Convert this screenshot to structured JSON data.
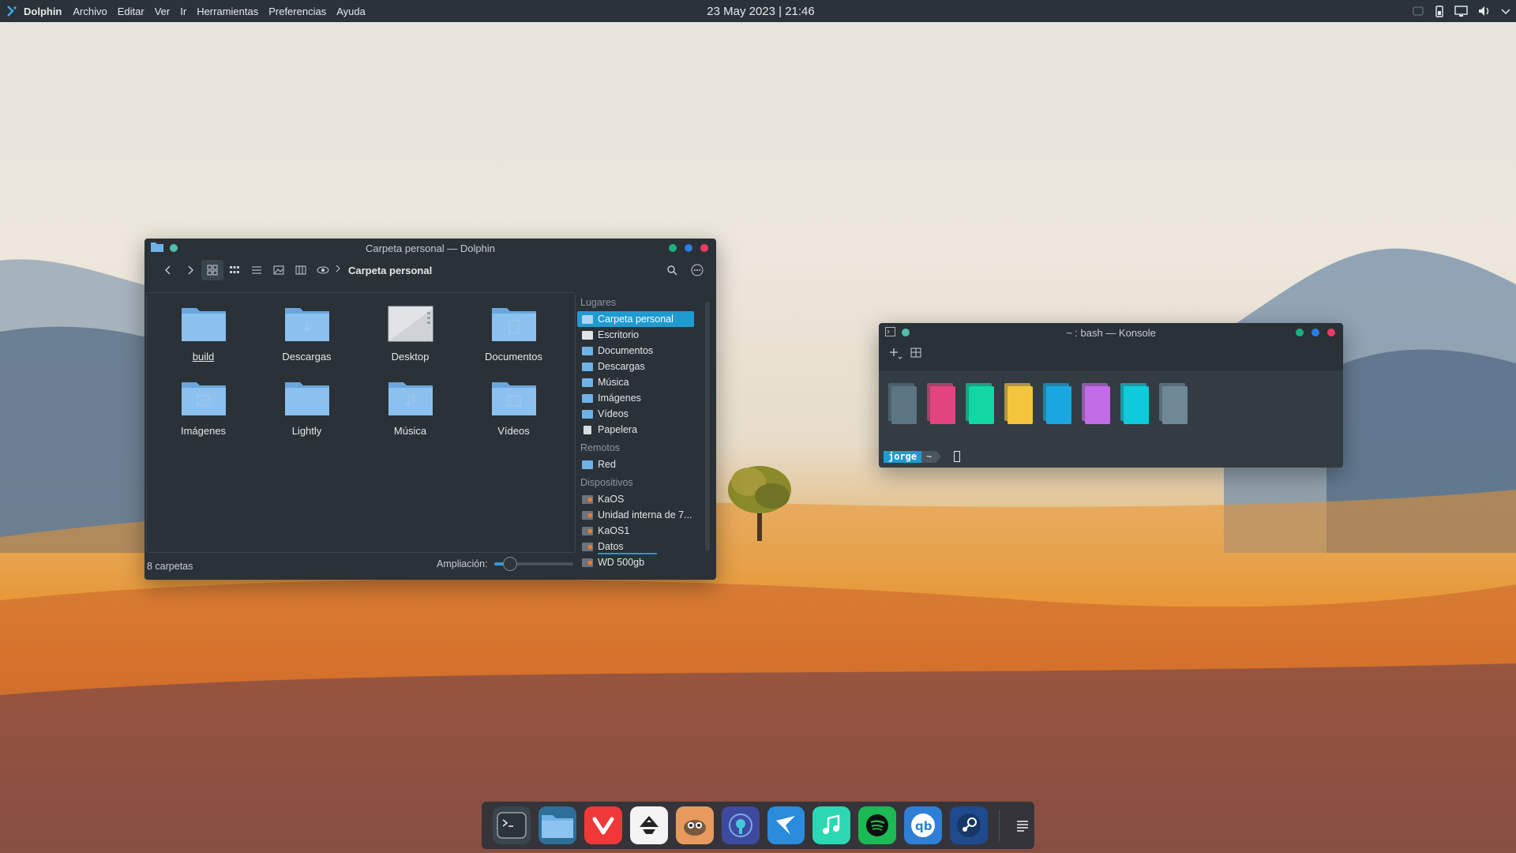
{
  "panel": {
    "app_name": "Dolphin",
    "menu": [
      "Archivo",
      "Editar",
      "Ver",
      "Ir",
      "Herramientas",
      "Preferencias",
      "Ayuda"
    ],
    "clock": "23 May 2023 | 21:46",
    "tray_icons": [
      "system-monitor-icon",
      "battery-icon",
      "display-icon",
      "volume-icon",
      "chevron-down-icon"
    ]
  },
  "dolphin": {
    "title": "Carpeta personal — Dolphin",
    "location": "Carpeta personal",
    "files": [
      {
        "name": "build",
        "icon": "folder"
      },
      {
        "name": "Descargas",
        "icon": "folder-download"
      },
      {
        "name": "Desktop",
        "icon": "folder-desktop"
      },
      {
        "name": "Documentos",
        "icon": "folder-documents"
      },
      {
        "name": "Imágenes",
        "icon": "folder-pictures"
      },
      {
        "name": "Lightly",
        "icon": "folder"
      },
      {
        "name": "Música",
        "icon": "folder-music"
      },
      {
        "name": "Vídeos",
        "icon": "folder-videos"
      }
    ],
    "status": "8 carpetas",
    "zoom_label": "Ampliación:",
    "zoom_level": 0.2,
    "places": {
      "section_places": "Lugares",
      "items": [
        "Carpeta personal",
        "Escritorio",
        "Documentos",
        "Descargas",
        "Música",
        "Imágenes",
        "Vídeos",
        "Papelera"
      ],
      "section_remote": "Remotos",
      "remote_items": [
        "Red"
      ],
      "section_devices": "Dispositivos",
      "devices": [
        "KaOS",
        "Unidad interna de 7...",
        "KaOS1",
        "Datos",
        "WD 500gb"
      ]
    }
  },
  "konsole": {
    "title": "~ : bash — Konsole",
    "palette": [
      "#5c7583",
      "#e3447f",
      "#10d7a4",
      "#f2c53d",
      "#1aa7df",
      "#c26be6",
      "#0ecbdb",
      "#6f8896"
    ],
    "prompt_user": "jorge",
    "prompt_dir": "~"
  },
  "dock": {
    "apps": [
      "terminal-icon",
      "file-manager-icon",
      "vivaldi-icon",
      "inkscape-icon",
      "gimp-icon",
      "audio-app-icon",
      "kite-icon",
      "music-icon",
      "spotify-icon",
      "qbittorrent-icon",
      "steam-icon",
      "menu-icon"
    ]
  },
  "colors": {
    "accent": "#1f9bd1",
    "window_bg": "#2a3137",
    "panel_bg": "#2b333a"
  }
}
